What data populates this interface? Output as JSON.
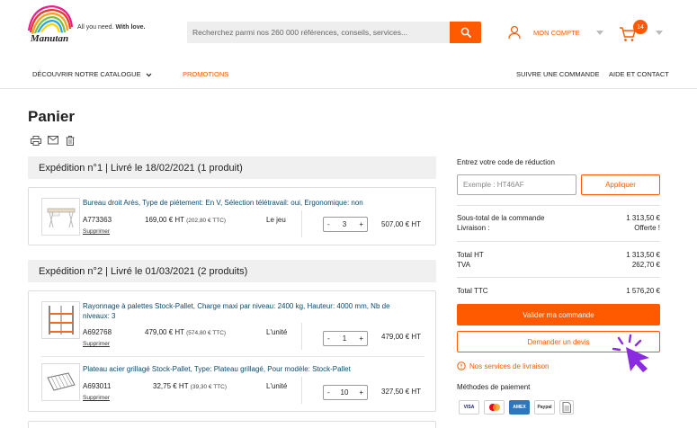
{
  "brand": {
    "logo_text": "Manutan",
    "tagline_prefix": "All you need.",
    "tagline_bold": "With love."
  },
  "search": {
    "placeholder": "Recherchez parmi nos 260 000 références, conseils, services..."
  },
  "account": {
    "label": "MON COMPTE"
  },
  "cart": {
    "count": "14"
  },
  "nav": {
    "catalogue": "DÉCOUVRIR NOTRE CATALOGUE",
    "promotions": "PROMOTIONS",
    "track": "SUIVRE UNE COMMANDE",
    "help": "AIDE ET CONTACT"
  },
  "page": {
    "title": "Panier"
  },
  "shipments": [
    {
      "title": "Expédition n°1 | Livré le 18/02/2021 (1 produit)",
      "items": [
        {
          "name": "Bureau droit Arès, Type de piétement: En V, Sélection télétravail: oui, Ergonomique: non",
          "ref": "A773363",
          "price_ht": "169,00 € HT",
          "price_ttc": "(202,80 € TTC)",
          "unit": "Le jeu",
          "qty": "3",
          "total": "507,00 € HT",
          "remove": "Supprimer"
        }
      ]
    },
    {
      "title": "Expédition n°2 | Livré le 01/03/2021 (2 produits)",
      "items": [
        {
          "name": "Rayonnage à palettes Stock-Pallet, Charge maxi par niveau: 2400 kg, Hauteur: 4000 mm, Nb de niveaux: 3",
          "ref": "A692768",
          "price_ht": "479,00 € HT",
          "price_ttc": "(574,80 € TTC)",
          "unit": "L'unité",
          "qty": "1",
          "total": "479,00 € HT",
          "remove": "Supprimer"
        },
        {
          "name": "Plateau acier grillagé Stock-Pallet, Type: Plateau grillagé, Pour modèle: Stock-Pallet",
          "ref": "A693011",
          "price_ht": "32,75 € HT",
          "price_ttc": "(39,30 € TTC)",
          "unit": "L'unité",
          "qty": "10",
          "total": "327,50 € HT",
          "remove": "Supprimer"
        }
      ]
    }
  ],
  "summary": {
    "coupon_label": "Entrez votre code de réduction",
    "coupon_placeholder": "Exemple : HT46AF",
    "apply": "Appliquer",
    "subtotal_label": "Sous-total de la commande",
    "subtotal_value": "1 313,50 €",
    "delivery_label": "Livraison :",
    "delivery_value": "Offerte !",
    "total_ht_label": "Total HT",
    "total_ht_value": "1 313,50 €",
    "tva_label": "TVA",
    "tva_value": "262,70 €",
    "total_ttc_label": "Total TTC",
    "total_ttc_value": "1 576,20 €",
    "validate": "Valider ma commande",
    "quote": "Demander un devis",
    "delivery_services": "Nos services de livraison",
    "payment_label": "Méthodes de paiement",
    "payment_cards": [
      "VISA",
      "MC",
      "AMEX",
      "Paypal",
      "Virement"
    ]
  },
  "colors": {
    "accent": "#ff5a00",
    "link": "#0b4a6e",
    "cursor": "#8a2be2"
  }
}
